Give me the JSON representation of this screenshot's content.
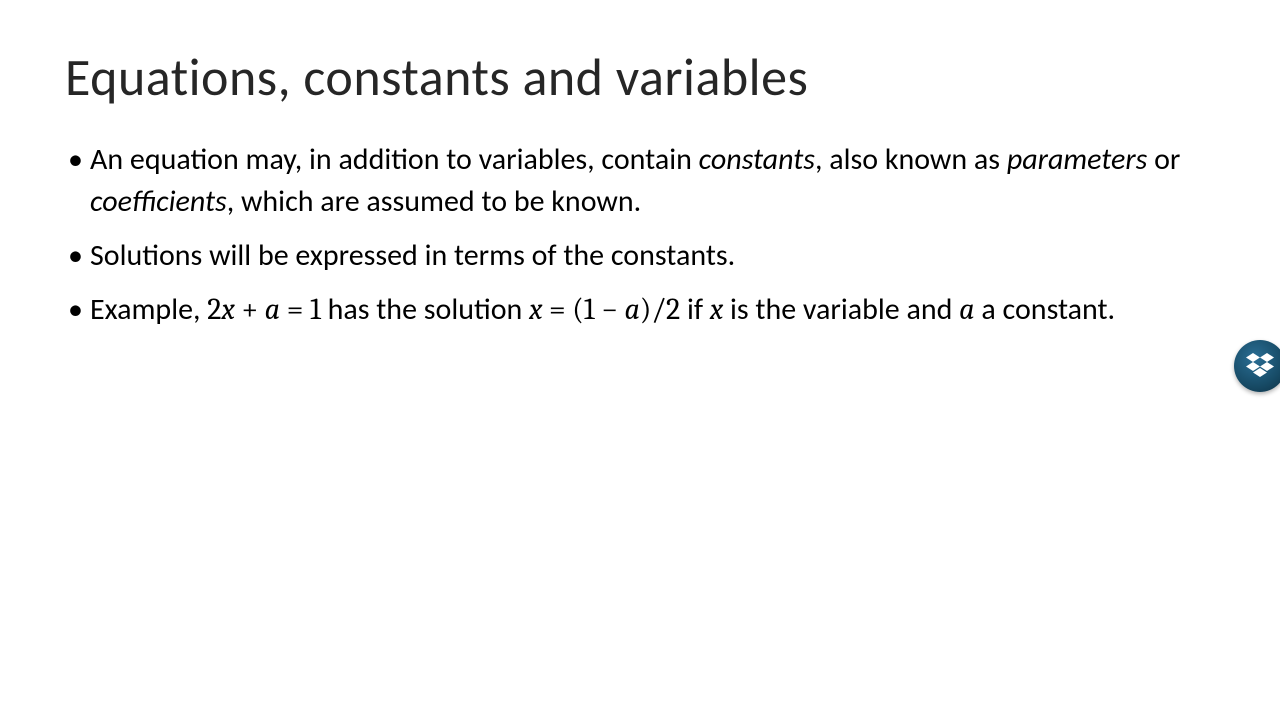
{
  "title": "Equations, constants and variables",
  "bullets": {
    "b1": {
      "p1": "An equation may, in addition to variables, contain ",
      "constants": "constants",
      "p2": ", also known as ",
      "parameters": "parameters",
      "p3": " or ",
      "coefficients": "coefficients",
      "p4": ", which are assumed to be known."
    },
    "b2": "Solutions will be expressed in terms of the constants.",
    "b3": {
      "p1": "Example, ",
      "eq1_2": "2",
      "eq1_x": "x",
      "eq1_plus": " + ",
      "eq1_a": "a",
      "eq1_eq": " = ",
      "eq1_1": "1",
      "p2": " has the solution ",
      "eq2_x": "x",
      "eq2_eq": " = (",
      "eq2_1": "1",
      "eq2_minus": " − ",
      "eq2_a": "a",
      "eq2_close": ")/2",
      "p3": " if ",
      "eq3_x": "x",
      "p4": " is the variable and ",
      "eq3_a": "a",
      "p5": " a constant."
    }
  },
  "badge_icon": "dropbox-icon"
}
